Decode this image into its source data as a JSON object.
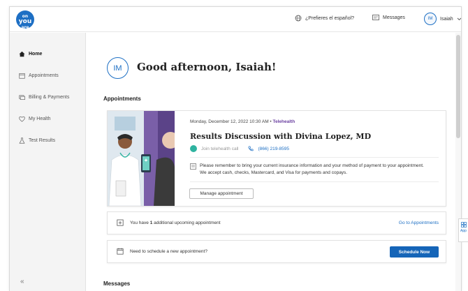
{
  "header": {
    "logo_small": "on",
    "logo_big": "you",
    "logo_bottom": "are",
    "language_label": "¿Prefieres el español?",
    "messages_label": "Messages",
    "user_initials": "IM",
    "user_name": "Isaiah"
  },
  "sidebar": {
    "items": [
      {
        "label": "Home",
        "icon": "home-icon",
        "active": true
      },
      {
        "label": "Appointments",
        "icon": "calendar-icon",
        "active": false
      },
      {
        "label": "Billing & Payments",
        "icon": "billing-icon",
        "active": false
      },
      {
        "label": "My Health",
        "icon": "heart-icon",
        "active": false
      },
      {
        "label": "Test Results",
        "icon": "flask-icon",
        "active": false
      }
    ],
    "collapse_label": "«"
  },
  "main": {
    "avatar_initials": "IM",
    "greeting": "Good afternoon, Isaiah!",
    "appointments_title": "Appointments",
    "appointment": {
      "datetime": "Monday, December 12, 2022 10:30 AM",
      "separator": " • ",
      "type": "Telehealth",
      "title": "Results Discussion with Divina Lopez, MD",
      "join_label": "Join telehealth call",
      "phone": "(866) 219-8595",
      "note": "Please remember to bring your current insurance information and your method of payment to your appointment. We accept cash, checks, Mastercard, and Visa for payments and copays.",
      "manage_label": "Manage appointment"
    },
    "upcoming": {
      "prefix": "You have ",
      "count": "1",
      "suffix": " additional upcoming appointment",
      "link": "Go to Appointments"
    },
    "schedule": {
      "label": "Need to schedule a new appointment?",
      "button": "Schedule Now"
    },
    "messages_title": "Messages"
  },
  "floating_tab": {
    "label": "App"
  },
  "colors": {
    "brand_blue": "#1d6fc4",
    "button_blue": "#1565b8",
    "telehealth_purple": "#6a3fa0",
    "telehealth_teal": "#2fb3a0"
  }
}
